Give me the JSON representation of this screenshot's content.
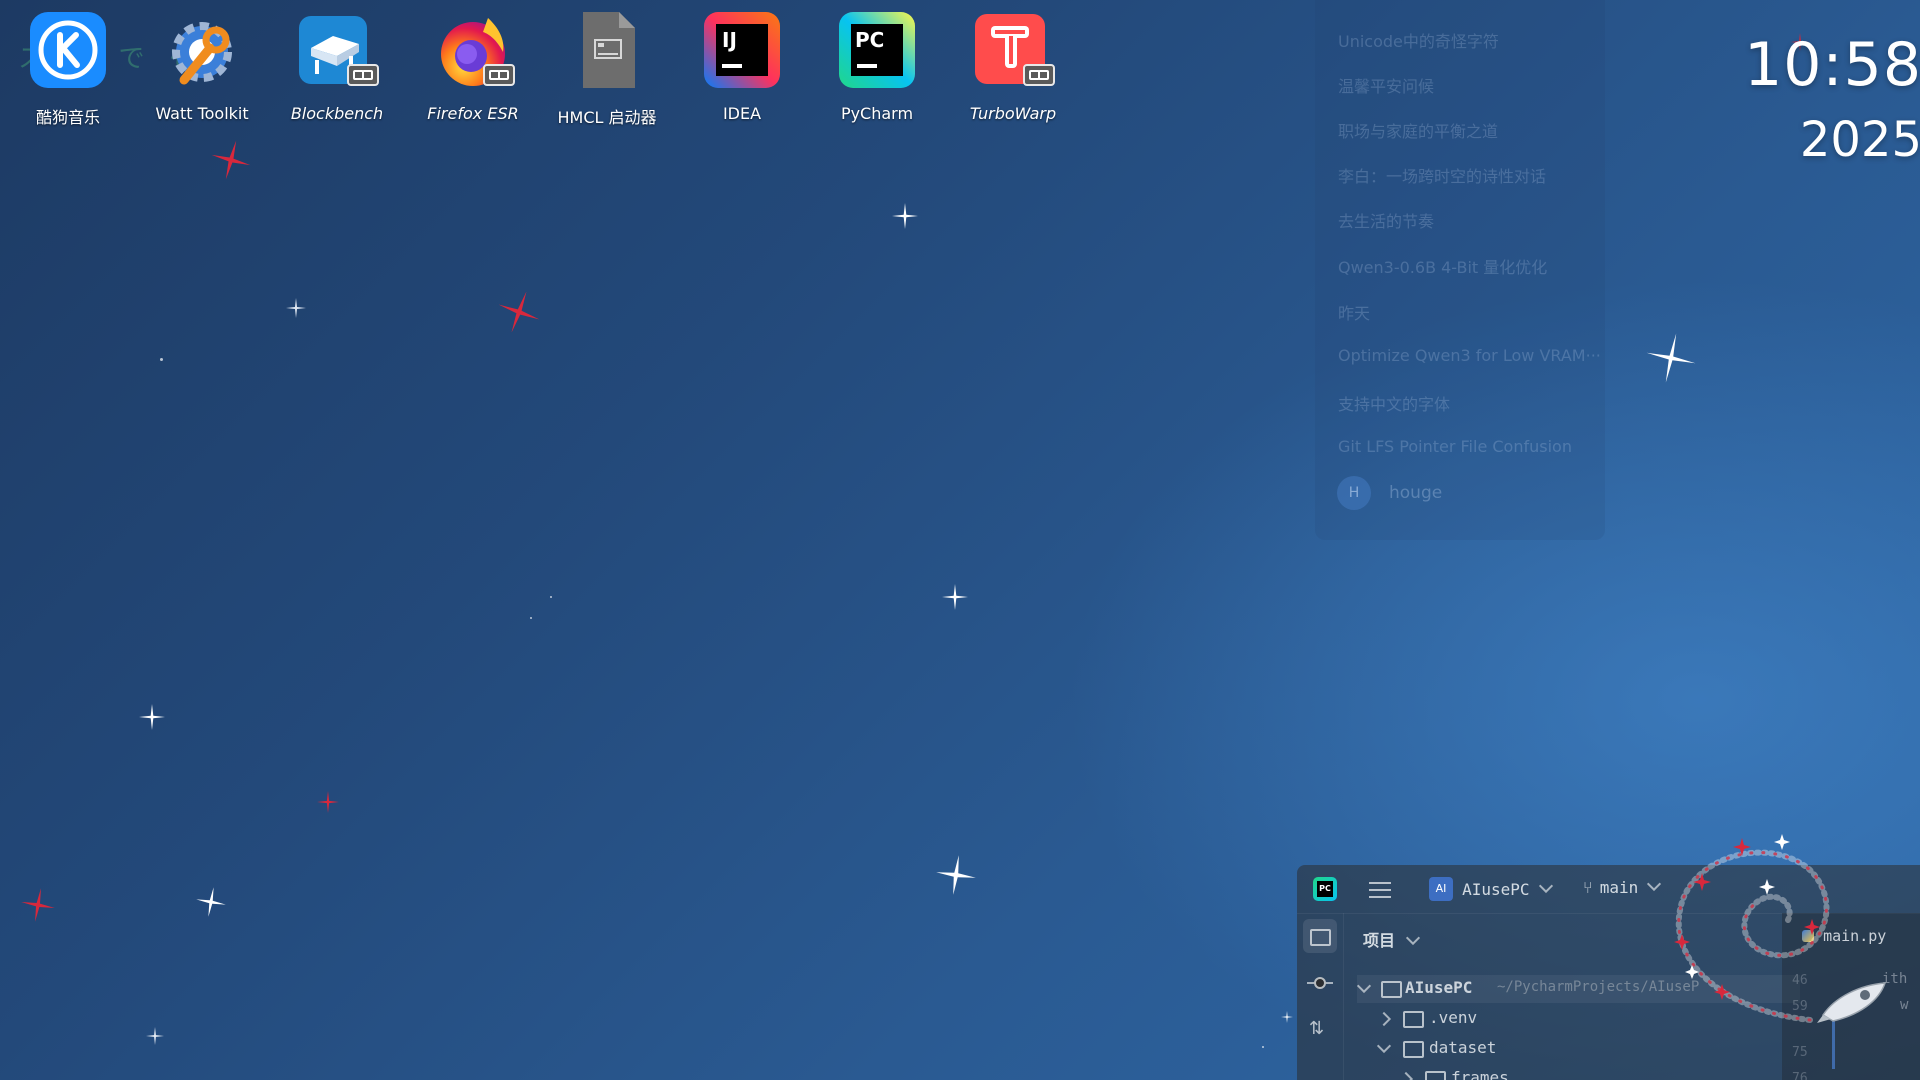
{
  "desktop": {
    "lyric_overlay": "ス 時 で も",
    "icons": [
      {
        "label": "酷狗音乐",
        "italic": false,
        "icon": "kugou-music-icon"
      },
      {
        "label": "Watt Toolkit",
        "italic": false,
        "icon": "watt-toolkit-icon"
      },
      {
        "label": "Blockbench",
        "italic": true,
        "icon": "blockbench-icon"
      },
      {
        "label": "Firefox ESR",
        "italic": true,
        "icon": "firefox-icon"
      },
      {
        "label": "HMCL 启动器",
        "italic": false,
        "icon": "file-icon"
      },
      {
        "label": "IDEA",
        "italic": false,
        "icon": "intellij-idea-icon"
      },
      {
        "label": "PyCharm",
        "italic": false,
        "icon": "pycharm-icon"
      },
      {
        "label": "TurboWarp",
        "italic": true,
        "icon": "turbowarp-icon"
      }
    ]
  },
  "clock": {
    "time": "10:58",
    "date": "2025"
  },
  "chat_history": {
    "items": [
      "Unicode中的奇怪字符",
      "温馨平安问候",
      "职场与家庭的平衡之道",
      "李白：一场跨时空的诗性对话",
      "去生活的节奏",
      "Qwen3-0.6B 4-Bit 量化优化",
      "昨天",
      "Optimize Qwen3 for Low VRAM···",
      "支持中文的字体",
      "Git LFS Pointer File Confusion"
    ],
    "avatar_initial": "H",
    "username": "houge"
  },
  "ide": {
    "logo": "PC",
    "project_badge": "AI",
    "project_name": "AIusePC",
    "branch": "main",
    "project_tab": "项目",
    "tree": [
      {
        "name": "AIusePC",
        "path": "~/PycharmProjects/AIuseP",
        "expanded": true,
        "level": 0
      },
      {
        "name": ".venv",
        "expanded": false,
        "level": 1
      },
      {
        "name": "dataset",
        "expanded": true,
        "level": 1
      },
      {
        "name": "frames",
        "expanded": false,
        "level": 2
      }
    ],
    "editor_tab": "main.py",
    "line_numbers": [
      "46",
      "59",
      "75",
      "76"
    ],
    "code_fragment_1": "ith",
    "code_fragment_2": "w"
  },
  "colors": {
    "desktop_bg": "#23497a",
    "star_white": "#ffffff",
    "star_red": "#d8283c",
    "ide_bg": "#2b2d30"
  }
}
